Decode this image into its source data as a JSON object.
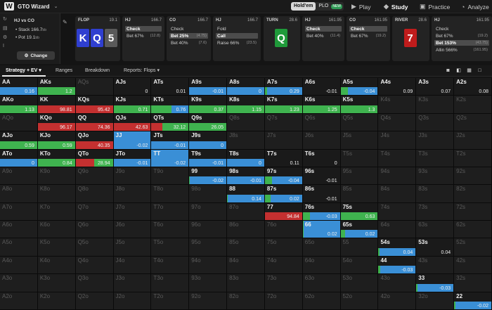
{
  "app": {
    "title": "GTO Wizard"
  },
  "topbar": {
    "mode_holdem": "Hold'em",
    "mode_plo": "PLO",
    "mode_plo_badge": "NEW",
    "nav": [
      {
        "label": "Play",
        "icon": "play-icon"
      },
      {
        "label": "Study",
        "icon": "study-icon"
      },
      {
        "label": "Practice",
        "icon": "practice-icon"
      },
      {
        "label": "Analyze",
        "icon": "analyze-icon"
      }
    ]
  },
  "left_panel": {
    "title": "HJ vs CO",
    "stack": "Stack 166.7",
    "stack_unit": "bb",
    "pot": "Pot 19.1",
    "pot_unit": "bb",
    "change_button": "Change"
  },
  "strips": [
    {
      "head": "FLOP",
      "stack": "19.1",
      "cards": [
        {
          "rank": "K",
          "color": "#2f3fd0"
        },
        {
          "rank": "Q",
          "color": "#2f3fd0"
        },
        {
          "rank": "5",
          "color": "#5a5a5a"
        }
      ]
    },
    {
      "head": "HJ",
      "stack": "166.7",
      "actions": [
        {
          "label": "Check",
          "sub": "",
          "sel": true
        },
        {
          "label": "Bet 67%",
          "sub": "(12.8)",
          "sel": false
        }
      ]
    },
    {
      "head": "CO",
      "stack": "166.7",
      "actions": [
        {
          "label": "Check",
          "sub": "",
          "sel": false
        },
        {
          "label": "Bet 25%",
          "sub": "(4.75)",
          "sel": true
        },
        {
          "label": "Bet 40%",
          "sub": "(7.6)",
          "sel": false
        }
      ]
    },
    {
      "head": "HJ",
      "stack": "166.7",
      "actions": [
        {
          "label": "Fold",
          "sub": "",
          "sel": false
        },
        {
          "label": "Call",
          "sub": "",
          "sel": true
        },
        {
          "label": "Raise 66%",
          "sub": "(23.5)",
          "sel": false
        }
      ]
    },
    {
      "head": "TURN",
      "stack": "28.6",
      "cards": [
        {
          "rank": "Q",
          "color": "#1f9a3a"
        }
      ]
    },
    {
      "head": "HJ",
      "stack": "161.95",
      "actions": [
        {
          "label": "Check",
          "sub": "",
          "sel": true
        },
        {
          "label": "Bet 40%",
          "sub": "(11.4)",
          "sel": false
        }
      ]
    },
    {
      "head": "CO",
      "stack": "161.95",
      "actions": [
        {
          "label": "Check",
          "sub": "",
          "sel": true
        },
        {
          "label": "Bet 67%",
          "sub": "(19.2)",
          "sel": false
        }
      ]
    },
    {
      "head": "RIVER",
      "stack": "28.6",
      "cards": [
        {
          "rank": "7",
          "color": "#c01c1c"
        }
      ]
    },
    {
      "head": "HJ",
      "stack": "161.95",
      "actions": [
        {
          "label": "Check",
          "sub": "",
          "sel": false
        },
        {
          "label": "Bet 67%",
          "sub": "(19.2)",
          "sel": false
        },
        {
          "label": "Bet 153%",
          "sub": "(43.75)",
          "sel": true
        },
        {
          "label": "Allin 566%",
          "sub": "(161.95)",
          "sel": false
        }
      ]
    }
  ],
  "tabs": [
    {
      "label": "Strategy + EV",
      "caret": true
    },
    {
      "label": "Ranges",
      "caret": false
    },
    {
      "label": "Breakdown",
      "caret": false
    },
    {
      "label": "Reports: Flops",
      "caret": true
    }
  ],
  "colors": {
    "check": "#3a8fd6",
    "call": "#3fb34f",
    "fold": "#2d6ec0",
    "raise": "#c43030",
    "bet": "#2fae4a"
  },
  "grid": {
    "ranks": [
      "A",
      "K",
      "Q",
      "J",
      "T",
      "9",
      "8",
      "7",
      "6",
      "5",
      "4",
      "3",
      "2"
    ],
    "active": {
      "AA": {
        "ev": "0.16",
        "bars": [
          [
            "#3a8fd6",
            1
          ]
        ]
      },
      "AKs": {
        "ev": "1.2",
        "bars": [
          [
            "#3fb34f",
            1
          ]
        ]
      },
      "AJs": {
        "ev": "0",
        "bars": []
      },
      "ATs": {
        "ev": "0.01",
        "bars": []
      },
      "A9s": {
        "ev": "-0.01",
        "bars": [
          [
            "#3a8fd6",
            1
          ]
        ]
      },
      "A8s": {
        "ev": "0",
        "bars": [
          [
            "#3a8fd6",
            1
          ]
        ]
      },
      "A7s": {
        "ev": "0.29",
        "bars": [
          [
            "#3fb34f",
            0.06
          ],
          [
            "#3a8fd6",
            0.94
          ]
        ]
      },
      "A6s": {
        "ev": "-0.01",
        "bars": []
      },
      "A5s": {
        "ev": "-0.04",
        "bars": [
          [
            "#3fb34f",
            0.2
          ],
          [
            "#3a8fd6",
            0.8
          ]
        ]
      },
      "A4s": {
        "ev": "0.09",
        "bars": []
      },
      "A3s": {
        "ev": "0.07",
        "bars": []
      },
      "A2s": {
        "ev": "0.08",
        "bars": []
      },
      "AKo": {
        "ev": "1.13",
        "bars": [
          [
            "#3fb34f",
            1
          ]
        ]
      },
      "KK": {
        "ev": "98.81",
        "bars": [
          [
            "#c43030",
            1
          ]
        ]
      },
      "KQs": {
        "ev": "95.42",
        "bars": [
          [
            "#c43030",
            1
          ]
        ]
      },
      "KJs": {
        "ev": "0.71",
        "bars": [
          [
            "#3fb34f",
            1
          ]
        ]
      },
      "KTs": {
        "ev": "0.76",
        "bars": [
          [
            "#3fb34f",
            0.55
          ],
          [
            "#3a8fd6",
            0.45
          ]
        ]
      },
      "K9s": {
        "ev": "0.37",
        "bars": [
          [
            "#3fb34f",
            1
          ]
        ]
      },
      "K8s": {
        "ev": "1.15",
        "bars": [
          [
            "#3fb34f",
            1
          ]
        ]
      },
      "K7s": {
        "ev": "1.23",
        "bars": [
          [
            "#3fb34f",
            1
          ]
        ]
      },
      "K6s": {
        "ev": "1.25",
        "bars": [
          [
            "#3fb34f",
            1
          ]
        ]
      },
      "K5s": {
        "ev": "1.3",
        "bars": [
          [
            "#3fb34f",
            1
          ]
        ]
      },
      "KQo": {
        "ev": "96.17",
        "bars": [
          [
            "#c43030",
            1
          ]
        ]
      },
      "QQ": {
        "ev": "74.36",
        "bars": [
          [
            "#c43030",
            1
          ]
        ]
      },
      "QJs": {
        "ev": "42.63",
        "bars": [
          [
            "#c43030",
            1
          ]
        ]
      },
      "QTs": {
        "ev": "32.12",
        "bars": [
          [
            "#c43030",
            0.3
          ],
          [
            "#3fb34f",
            0.7
          ]
        ]
      },
      "Q9s": {
        "ev": "26.05",
        "bars": [
          [
            "#3fb34f",
            1
          ]
        ]
      },
      "AJo": {
        "ev": "0.59",
        "bars": [
          [
            "#3fb34f",
            1
          ]
        ]
      },
      "KJo": {
        "ev": "0.59",
        "bars": [
          [
            "#3fb34f",
            1
          ]
        ]
      },
      "QJo": {
        "ev": "40.35",
        "bars": [
          [
            "#c43030",
            1
          ]
        ]
      },
      "JJ": {
        "ev": "-0.02",
        "bars": [
          [
            "#3a8fd6",
            1
          ]
        ],
        "full": true
      },
      "JTs": {
        "ev": "-0.01",
        "bars": [
          [
            "#3a8fd6",
            1
          ]
        ]
      },
      "J9s": {
        "ev": "0",
        "bars": [
          [
            "#3a8fd6",
            1
          ]
        ]
      },
      "ATo": {
        "ev": "0",
        "bars": [
          [
            "#3a8fd6",
            1
          ]
        ]
      },
      "KTo": {
        "ev": "0.84",
        "bars": [
          [
            "#3fb34f",
            1
          ]
        ]
      },
      "QTo": {
        "ev": "28.94",
        "bars": [
          [
            "#c43030",
            0.5
          ],
          [
            "#3fb34f",
            0.5
          ]
        ]
      },
      "JTo": {
        "ev": "-0.01",
        "bars": [
          [
            "#3a8fd6",
            1
          ]
        ]
      },
      "TT": {
        "ev": "-0.02",
        "bars": [
          [
            "#3a8fd6",
            1
          ]
        ],
        "full": true
      },
      "T9s": {
        "ev": "-0.01",
        "bars": [
          [
            "#3a8fd6",
            1
          ]
        ]
      },
      "T8s": {
        "ev": "0",
        "bars": [
          [
            "#3a8fd6",
            1
          ]
        ]
      },
      "T7s": {
        "ev": "0.11",
        "bars": []
      },
      "T6s": {
        "ev": "0",
        "bars": []
      },
      "99": {
        "ev": "-0.02",
        "bars": [
          [
            "#3fb34f",
            0.02
          ],
          [
            "#3a8fd6",
            0.98
          ]
        ]
      },
      "98s": {
        "ev": "-0.01",
        "bars": [
          [
            "#3a8fd6",
            1
          ]
        ]
      },
      "97s": {
        "ev": "-0.04",
        "bars": [
          [
            "#3fb34f",
            0.2
          ],
          [
            "#3a8fd6",
            0.8
          ]
        ]
      },
      "96s": {
        "ev": "-0.01",
        "bars": []
      },
      "88": {
        "ev": "0.14",
        "bars": [
          [
            "#3fb34f",
            0.02
          ],
          [
            "#3a8fd6",
            0.98
          ]
        ]
      },
      "87s": {
        "ev": "0.02",
        "bars": [
          [
            "#3fb34f",
            0.15
          ],
          [
            "#3a8fd6",
            0.85
          ]
        ]
      },
      "86s": {
        "ev": "-0.01",
        "bars": []
      },
      "77": {
        "ev": "94.84",
        "bars": [
          [
            "#c43030",
            1
          ]
        ]
      },
      "76s": {
        "ev": "-0.03",
        "bars": [
          [
            "#3fb34f",
            0.2
          ],
          [
            "#3a8fd6",
            0.8
          ]
        ]
      },
      "75s": {
        "ev": "0.63",
        "bars": [
          [
            "#3fb34f",
            1
          ]
        ]
      },
      "66": {
        "ev": "0.02",
        "bars": [
          [
            "#3fb34f",
            0.02
          ],
          [
            "#3a8fd6",
            0.98
          ]
        ],
        "full": true
      },
      "65s": {
        "ev": "0.02",
        "bars": [
          [
            "#3fb34f",
            0.12
          ],
          [
            "#3a8fd6",
            0.88
          ]
        ]
      },
      "54s": {
        "ev": "0.04",
        "bars": [
          [
            "#3fb34f",
            0.02
          ],
          [
            "#3a8fd6",
            0.98
          ]
        ]
      },
      "53s": {
        "ev": "0.04",
        "bars": []
      },
      "44": {
        "ev": "-0.03",
        "bars": [
          [
            "#3fb34f",
            0.04
          ],
          [
            "#3a8fd6",
            0.96
          ]
        ]
      },
      "33": {
        "ev": "-0.03",
        "bars": [
          [
            "#3fb34f",
            0.04
          ],
          [
            "#3a8fd6",
            0.96
          ]
        ]
      },
      "22": {
        "ev": "-0.02",
        "bars": [
          [
            "#3fb34f",
            0.04
          ],
          [
            "#3a8fd6",
            0.96
          ]
        ]
      }
    }
  }
}
